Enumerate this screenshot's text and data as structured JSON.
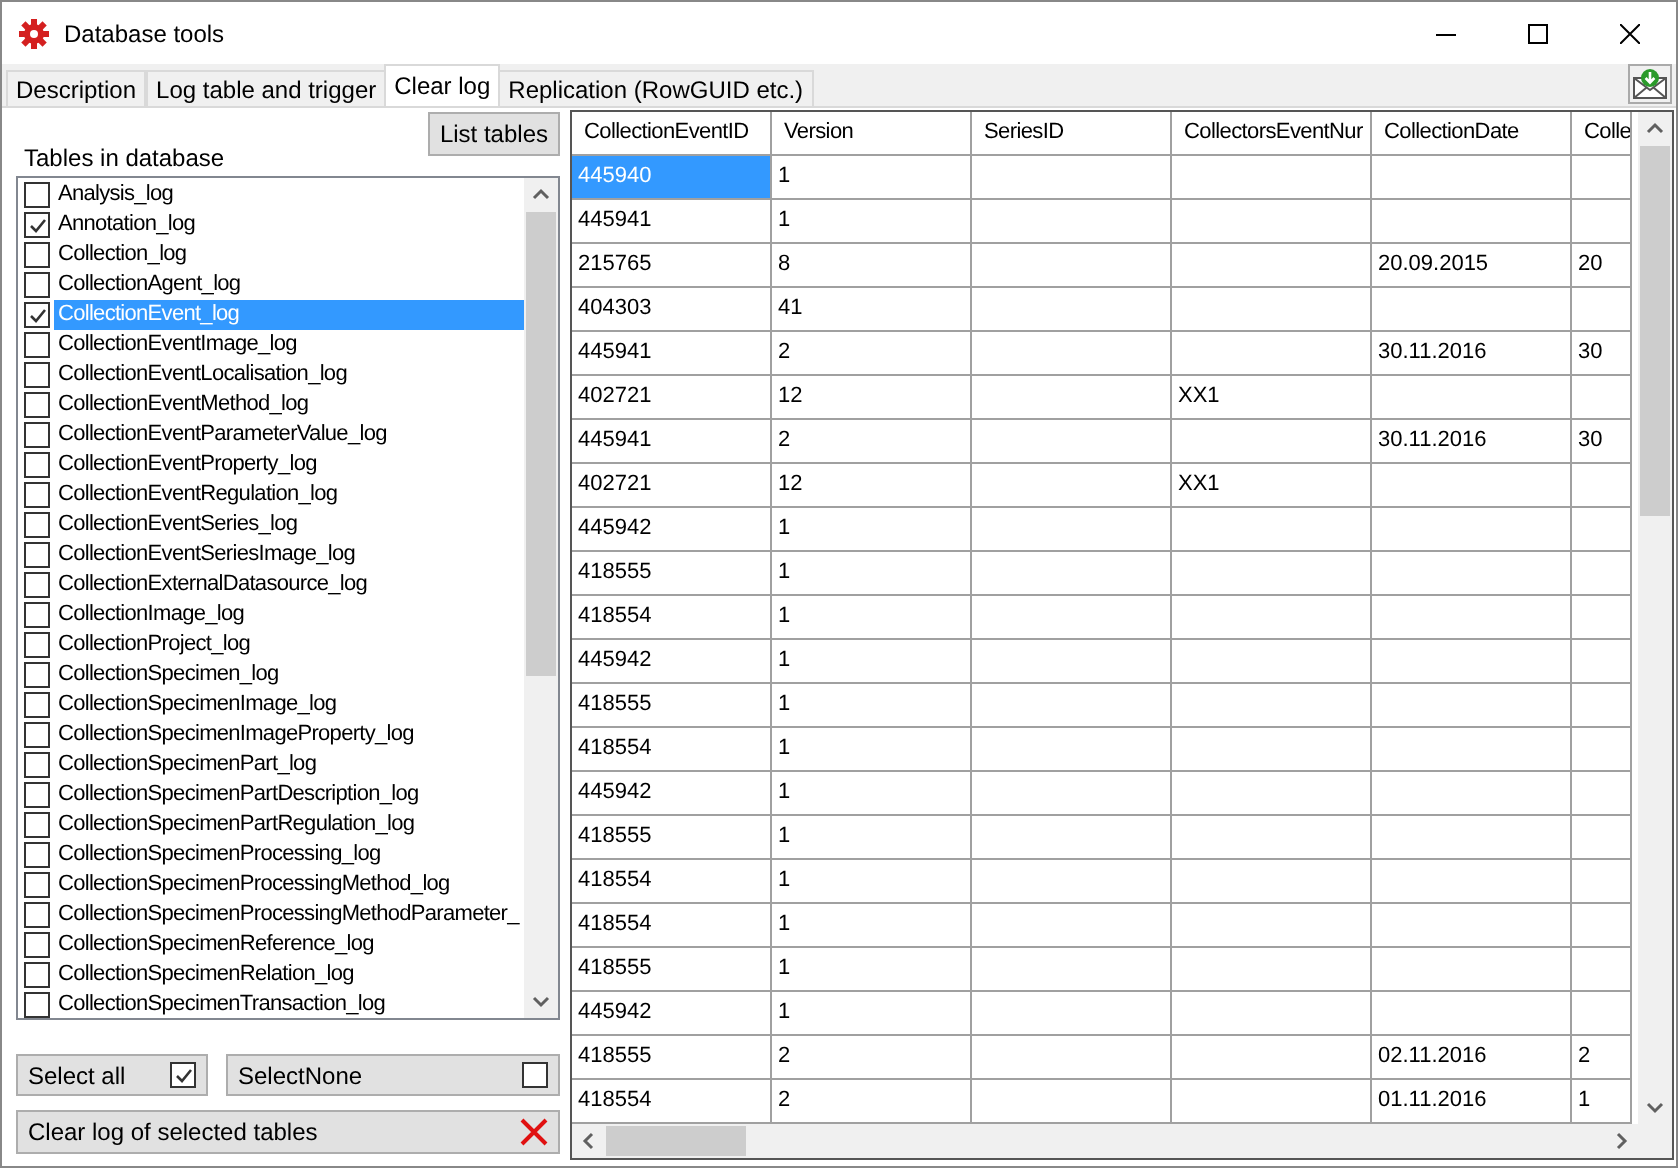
{
  "window": {
    "title": "Database tools"
  },
  "tabs": [
    {
      "label": "Description",
      "selected": false
    },
    {
      "label": "Log table and trigger",
      "selected": false
    },
    {
      "label": "Clear log",
      "selected": true
    },
    {
      "label": "Replication (RowGUID etc.)",
      "selected": false
    }
  ],
  "left_panel": {
    "list_button": "List tables",
    "list_label": "Tables in database",
    "tables": [
      {
        "name": "Analysis_log",
        "checked": false,
        "selected": false
      },
      {
        "name": "Annotation_log",
        "checked": true,
        "selected": false
      },
      {
        "name": "Collection_log",
        "checked": false,
        "selected": false
      },
      {
        "name": "CollectionAgent_log",
        "checked": false,
        "selected": false
      },
      {
        "name": "CollectionEvent_log",
        "checked": true,
        "selected": true
      },
      {
        "name": "CollectionEventImage_log",
        "checked": false,
        "selected": false
      },
      {
        "name": "CollectionEventLocalisation_log",
        "checked": false,
        "selected": false
      },
      {
        "name": "CollectionEventMethod_log",
        "checked": false,
        "selected": false
      },
      {
        "name": "CollectionEventParameterValue_log",
        "checked": false,
        "selected": false
      },
      {
        "name": "CollectionEventProperty_log",
        "checked": false,
        "selected": false
      },
      {
        "name": "CollectionEventRegulation_log",
        "checked": false,
        "selected": false
      },
      {
        "name": "CollectionEventSeries_log",
        "checked": false,
        "selected": false
      },
      {
        "name": "CollectionEventSeriesImage_log",
        "checked": false,
        "selected": false
      },
      {
        "name": "CollectionExternalDatasource_log",
        "checked": false,
        "selected": false
      },
      {
        "name": "CollectionImage_log",
        "checked": false,
        "selected": false
      },
      {
        "name": "CollectionProject_log",
        "checked": false,
        "selected": false
      },
      {
        "name": "CollectionSpecimen_log",
        "checked": false,
        "selected": false
      },
      {
        "name": "CollectionSpecimenImage_log",
        "checked": false,
        "selected": false
      },
      {
        "name": "CollectionSpecimenImageProperty_log",
        "checked": false,
        "selected": false
      },
      {
        "name": "CollectionSpecimenPart_log",
        "checked": false,
        "selected": false
      },
      {
        "name": "CollectionSpecimenPartDescription_log",
        "checked": false,
        "selected": false
      },
      {
        "name": "CollectionSpecimenPartRegulation_log",
        "checked": false,
        "selected": false
      },
      {
        "name": "CollectionSpecimenProcessing_log",
        "checked": false,
        "selected": false
      },
      {
        "name": "CollectionSpecimenProcessingMethod_log",
        "checked": false,
        "selected": false
      },
      {
        "name": "CollectionSpecimenProcessingMethodParameter_",
        "checked": false,
        "selected": false
      },
      {
        "name": "CollectionSpecimenReference_log",
        "checked": false,
        "selected": false
      },
      {
        "name": "CollectionSpecimenRelation_log",
        "checked": false,
        "selected": false
      },
      {
        "name": "CollectionSpecimenTransaction_log",
        "checked": false,
        "selected": false
      }
    ],
    "select_all": {
      "label": "Select all",
      "checked": true
    },
    "select_none": {
      "label": "SelectNone",
      "checked": false
    },
    "clear_button": "Clear log of selected tables"
  },
  "table": {
    "columns": [
      "CollectionEventID",
      "Version",
      "SeriesID",
      "CollectorsEventNur",
      "CollectionDate",
      "Colle"
    ],
    "rows": [
      {
        "selected": true,
        "cells": [
          "445940",
          "1",
          "",
          "",
          "",
          ""
        ]
      },
      {
        "selected": false,
        "cells": [
          "445941",
          "1",
          "",
          "",
          "",
          ""
        ]
      },
      {
        "selected": false,
        "cells": [
          "215765",
          "8",
          "",
          "",
          "20.09.2015",
          "20"
        ]
      },
      {
        "selected": false,
        "cells": [
          "404303",
          "41",
          "",
          "",
          "",
          ""
        ]
      },
      {
        "selected": false,
        "cells": [
          "445941",
          "2",
          "",
          "",
          "30.11.2016",
          "30"
        ]
      },
      {
        "selected": false,
        "cells": [
          "402721",
          "12",
          "",
          "XX1",
          "",
          ""
        ]
      },
      {
        "selected": false,
        "cells": [
          "445941",
          "2",
          "",
          "",
          "30.11.2016",
          "30"
        ]
      },
      {
        "selected": false,
        "cells": [
          "402721",
          "12",
          "",
          "XX1",
          "",
          ""
        ]
      },
      {
        "selected": false,
        "cells": [
          "445942",
          "1",
          "",
          "",
          "",
          ""
        ]
      },
      {
        "selected": false,
        "cells": [
          "418555",
          "1",
          "",
          "",
          "",
          ""
        ]
      },
      {
        "selected": false,
        "cells": [
          "418554",
          "1",
          "",
          "",
          "",
          ""
        ]
      },
      {
        "selected": false,
        "cells": [
          "445942",
          "1",
          "",
          "",
          "",
          ""
        ]
      },
      {
        "selected": false,
        "cells": [
          "418555",
          "1",
          "",
          "",
          "",
          ""
        ]
      },
      {
        "selected": false,
        "cells": [
          "418554",
          "1",
          "",
          "",
          "",
          ""
        ]
      },
      {
        "selected": false,
        "cells": [
          "445942",
          "1",
          "",
          "",
          "",
          ""
        ]
      },
      {
        "selected": false,
        "cells": [
          "418555",
          "1",
          "",
          "",
          "",
          ""
        ]
      },
      {
        "selected": false,
        "cells": [
          "418554",
          "1",
          "",
          "",
          "",
          ""
        ]
      },
      {
        "selected": false,
        "cells": [
          "418554",
          "1",
          "",
          "",
          "",
          ""
        ]
      },
      {
        "selected": false,
        "cells": [
          "418555",
          "1",
          "",
          "",
          "",
          ""
        ]
      },
      {
        "selected": false,
        "cells": [
          "445942",
          "1",
          "",
          "",
          "",
          ""
        ]
      },
      {
        "selected": false,
        "cells": [
          "418555",
          "2",
          "",
          "",
          "02.11.2016",
          "2"
        ]
      },
      {
        "selected": false,
        "cells": [
          "418554",
          "2",
          "",
          "",
          "01.11.2016",
          "1"
        ]
      }
    ]
  }
}
